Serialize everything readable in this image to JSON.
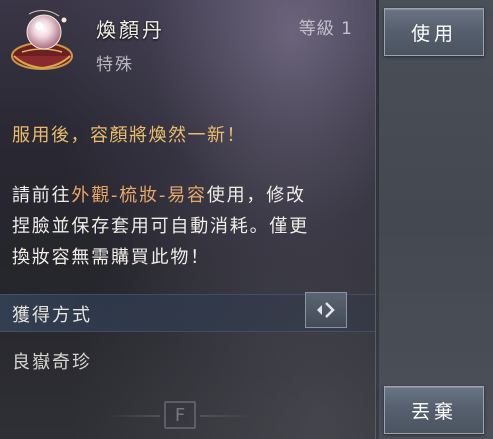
{
  "item": {
    "name": "煥顏丹",
    "type": "特殊",
    "level": "等級 1",
    "icon": "elixir-orb-pouch-icon"
  },
  "effect": "服用後，容顏將煥然一新！",
  "description": {
    "line1_pre": "請前往",
    "line1_hl": "外觀-梳妝-易容",
    "line1_post": "使用，修改",
    "line2": "捏臉並保存套用可自動消耗。僅更",
    "line3": "換妝容無需購買此物！"
  },
  "acquisition": {
    "title": "獲得方式",
    "value": "良嶽奇珍",
    "arrow_icon": "arrow-right-icon"
  },
  "hint_key": "F",
  "buttons": {
    "use": "使用",
    "discard": "丟棄"
  },
  "colors": {
    "accent_gold": "#e9bd6c",
    "accent_orange": "#e8a86a",
    "button_bg": "#5a6472"
  }
}
